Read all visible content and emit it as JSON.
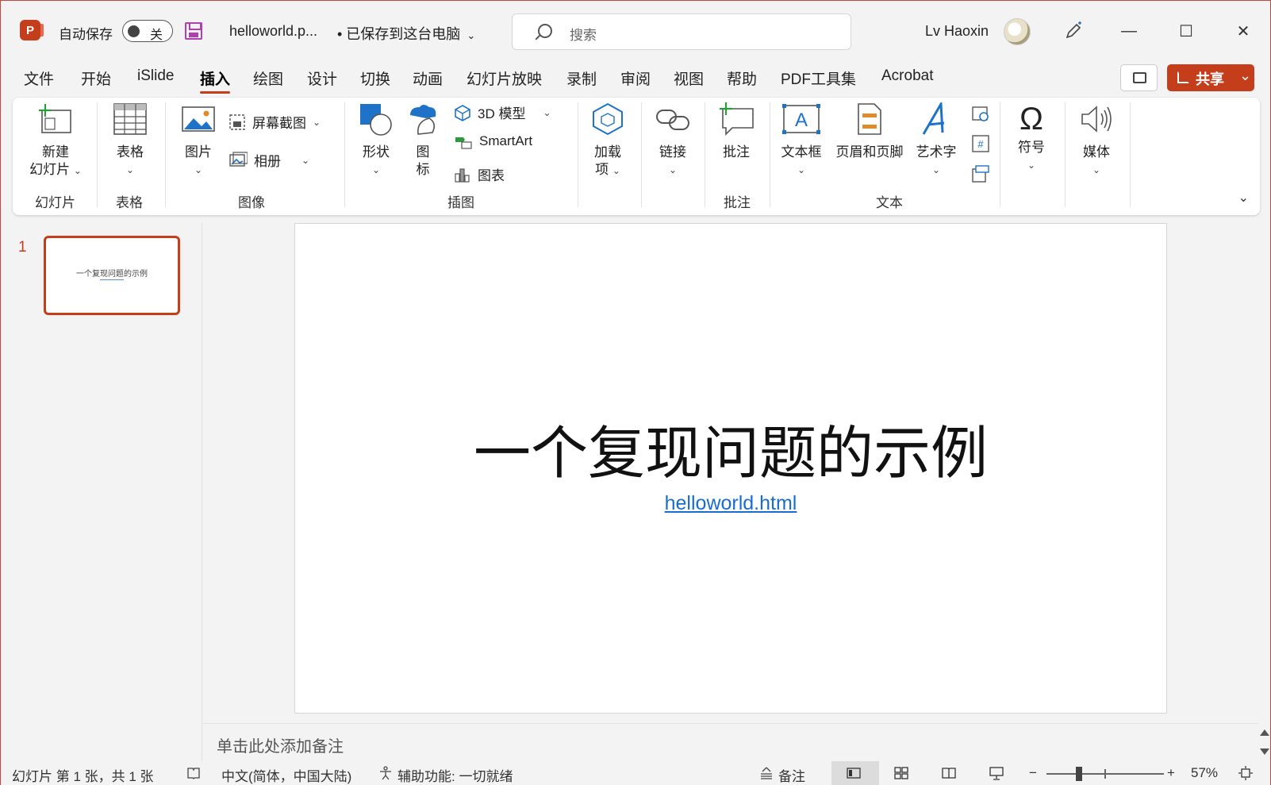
{
  "titlebar": {
    "autosave_label": "自动保存",
    "autosave_state": "关",
    "doc_title": "helloworld.p...",
    "doc_status": "• 已保存到这台电脑",
    "search_placeholder": "搜索",
    "user_name": "Lv Haoxin",
    "app_logo": "P"
  },
  "menu": {
    "items": [
      "文件",
      "开始",
      "iSlide",
      "插入",
      "绘图",
      "设计",
      "切换",
      "动画",
      "幻灯片放映",
      "录制",
      "审阅",
      "视图",
      "帮助",
      "PDF工具集",
      "Acrobat"
    ],
    "active": "插入",
    "share_label": "共享"
  },
  "ribbon": {
    "new_slide": [
      "新建",
      "幻灯片"
    ],
    "table": "表格",
    "picture": "图片",
    "screenshot": "屏幕截图",
    "album": "相册",
    "shapes": "形状",
    "icons": [
      "图",
      "标"
    ],
    "model3d": "3D 模型",
    "smartart": "SmartArt",
    "chart": "图表",
    "addins": [
      "加载",
      "项"
    ],
    "link": "链接",
    "comment": "批注",
    "textbox": "文本框",
    "header_footer": "页眉和页脚",
    "wordart": "艺术字",
    "symbol": "符号",
    "media": "媒体",
    "groups": {
      "slides": "幻灯片",
      "tables": "表格",
      "images": "图像",
      "illustrations": "插图",
      "comments": "批注",
      "text": "文本"
    }
  },
  "slides": {
    "current_number": "1",
    "thumb_title": "一个复现问题的示例"
  },
  "slide": {
    "title": "一个复现问题的示例",
    "link": "helloworld.html"
  },
  "notes": {
    "placeholder": "单击此处添加备注"
  },
  "statusbar": {
    "slide_info": "幻灯片 第 1 张，共 1 张",
    "language": "中文(简体，中国大陆)",
    "accessibility": "辅助功能: 一切就绪",
    "notes_label": "备注",
    "zoom_minus": "−",
    "zoom_plus": "+",
    "zoom_level": "57%"
  },
  "colors": {
    "accent": "#c43e1c",
    "link": "#1a6dd0",
    "ribbon_icon_blue": "#1e73c9"
  }
}
